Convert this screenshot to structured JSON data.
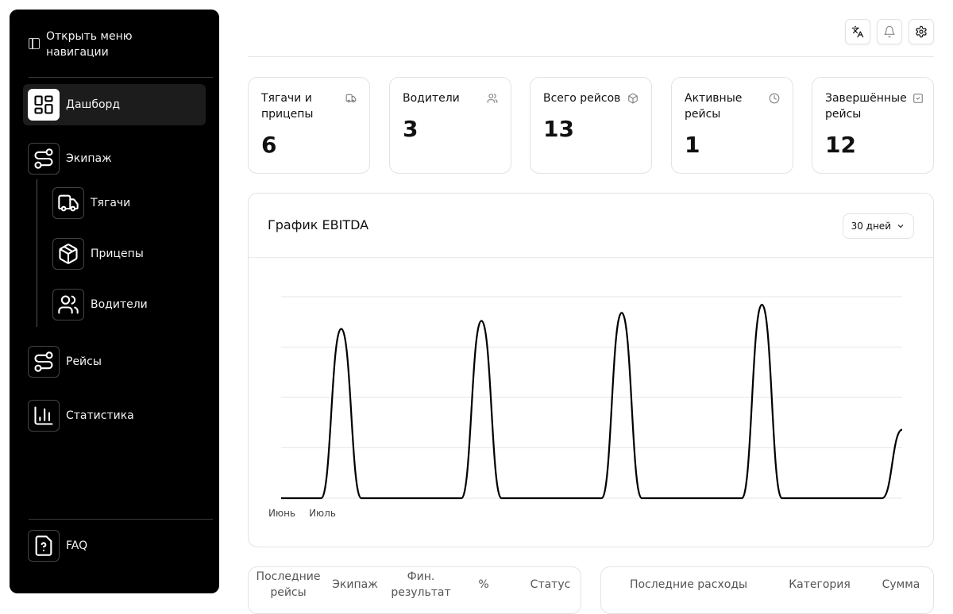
{
  "sidebar": {
    "toggle_label": "Открыть меню навигации",
    "items": [
      {
        "label": "Дашборд",
        "icon": "dashboard-icon"
      },
      {
        "label": "Экипаж",
        "icon": "route-icon"
      },
      {
        "label": "Тягачи",
        "icon": "truck-icon"
      },
      {
        "label": "Прицепы",
        "icon": "package-icon"
      },
      {
        "label": "Водители",
        "icon": "users-icon"
      },
      {
        "label": "Рейсы",
        "icon": "route-icon"
      },
      {
        "label": "Статистика",
        "icon": "bar-chart-icon"
      }
    ],
    "faq_label": "FAQ"
  },
  "header": {
    "buttons": [
      "translate-icon",
      "bell-icon",
      "gear-icon"
    ]
  },
  "stats": [
    {
      "title": "Тягачи и прицепы",
      "value": "6",
      "icon": "truck-icon"
    },
    {
      "title": "Водители",
      "value": "3",
      "icon": "users-icon"
    },
    {
      "title": "Всего рейсов",
      "value": "13",
      "icon": "package-icon"
    },
    {
      "title": "Активные рейсы",
      "value": "1",
      "icon": "clock-icon"
    },
    {
      "title": "Завершённые рейсы",
      "value": "12",
      "icon": "check-square-icon"
    }
  ],
  "chart": {
    "title": "График EBITDA",
    "range_label": "30 дней"
  },
  "chart_data": {
    "type": "line",
    "title": "График EBITDA",
    "x_tick_labels": [
      "Июнь",
      "Июль"
    ],
    "series": [
      {
        "values": [
          0,
          0,
          0,
          0.84,
          0,
          0,
          0,
          0,
          0,
          0,
          0.88,
          0,
          0,
          0,
          0,
          0,
          0,
          0.92,
          0,
          0,
          0,
          0,
          0,
          0,
          0.96,
          0,
          0,
          0,
          0,
          0,
          0,
          0.34
        ]
      }
    ],
    "ylim": [
      0,
      1
    ],
    "grid": true
  },
  "tables": {
    "trips": {
      "headers": [
        "Последние рейсы",
        "Экипаж",
        "Фин. результат",
        "%",
        "Статус"
      ]
    },
    "expenses": {
      "headers": [
        "Последние расходы",
        "Категория",
        "Сумма"
      ]
    }
  }
}
